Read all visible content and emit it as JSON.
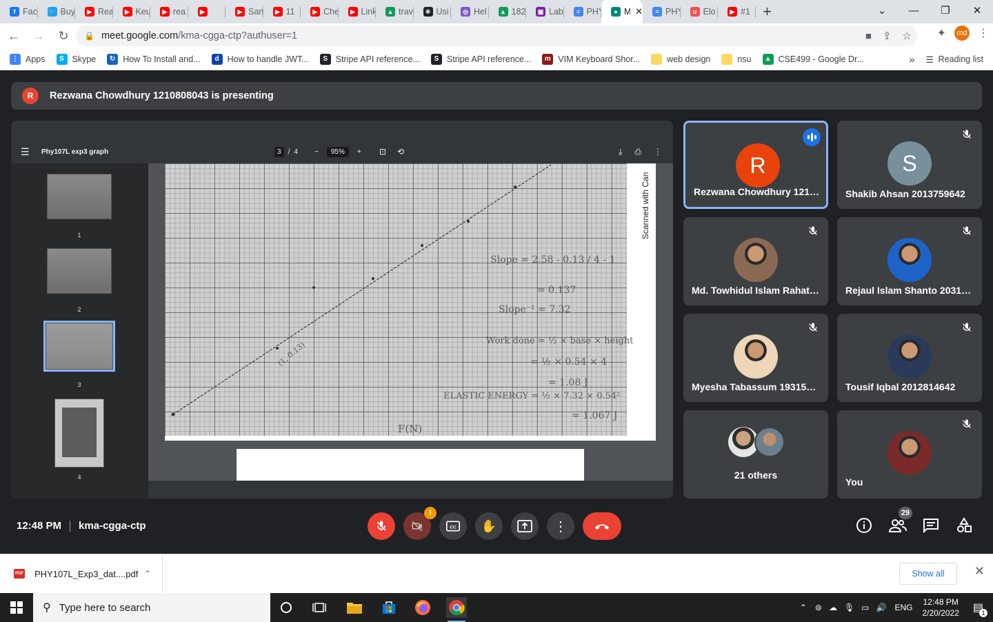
{
  "browser": {
    "tabs": [
      {
        "label": "Face",
        "color": "#1877f2",
        "glyph": "f"
      },
      {
        "label": "Buy",
        "color": "#1da1f2",
        "glyph": "🐦"
      },
      {
        "label": "Rea",
        "color": "#ff0000",
        "glyph": "▶"
      },
      {
        "label": "Keu",
        "color": "#ff0000",
        "glyph": "▶"
      },
      {
        "label": "rea",
        "color": "#ff0000",
        "glyph": "▶"
      },
      {
        "label": "",
        "color": "#ff0000",
        "glyph": "▶"
      },
      {
        "label": "San",
        "color": "#ff0000",
        "glyph": "▶"
      },
      {
        "label": "11",
        "color": "#ff0000",
        "glyph": "▶"
      },
      {
        "label": "Che",
        "color": "#ff0000",
        "glyph": "▶"
      },
      {
        "label": "Link",
        "color": "#ff0000",
        "glyph": "▶"
      },
      {
        "label": "trav",
        "color": "#0f9d58",
        "glyph": "▲"
      },
      {
        "label": "Usi",
        "color": "#20232a",
        "glyph": "⚛"
      },
      {
        "label": "Hel",
        "color": "#7e57c2",
        "glyph": "◎"
      },
      {
        "label": "182",
        "color": "#0f9d58",
        "glyph": "▲"
      },
      {
        "label": "Lab",
        "color": "#7b1fa2",
        "glyph": "▣"
      },
      {
        "label": "PHY",
        "color": "#4285f4",
        "glyph": "≡"
      },
      {
        "label": "M",
        "color": "#00897b",
        "glyph": "●",
        "active": true
      },
      {
        "label": "PHY",
        "color": "#4285f4",
        "glyph": "≡"
      },
      {
        "label": "Elo",
        "color": "#ef5350",
        "glyph": "ʊ"
      },
      {
        "label": "#1",
        "color": "#ff0000",
        "glyph": "▶"
      }
    ],
    "url_host": "meet.google.com",
    "url_path": "/kma-cgga-ctp?authuser=1",
    "profile_initials": "md",
    "bookmarks": [
      {
        "label": "Apps",
        "color": "#4285f4",
        "glyph": "⋮"
      },
      {
        "label": "Skype",
        "color": "#00aff0",
        "glyph": "S"
      },
      {
        "label": "How To Install and...",
        "color": "#1565c0",
        "glyph": "↻"
      },
      {
        "label": "How to handle JWT...",
        "color": "#0d47a1",
        "glyph": "d"
      },
      {
        "label": "Stripe API reference...",
        "color": "#202124",
        "glyph": "S"
      },
      {
        "label": "Stripe API reference...",
        "color": "#202124",
        "glyph": "S"
      },
      {
        "label": "VIM Keyboard Shor...",
        "color": "#8b1a1a",
        "glyph": "m"
      },
      {
        "label": "web design",
        "color": "#fdd663",
        "glyph": ""
      },
      {
        "label": "nsu",
        "color": "#fdd663",
        "glyph": ""
      },
      {
        "label": "CSE499 - Google Dr...",
        "color": "#0f9d58",
        "glyph": "▲"
      }
    ],
    "reading_list": "Reading list"
  },
  "meet": {
    "presenter_initial": "R",
    "presenting_text": "Rezwana Chowdhury 1210808043 is presenting",
    "pdf": {
      "title": "Phy107L exp3 graph",
      "page_current": "3",
      "page_total": "4",
      "zoom": "95%",
      "thumb_labels": [
        "1",
        "2",
        "3",
        "4"
      ],
      "scanned_label": "Scanned with Can",
      "handwriting": {
        "slope": "Slope = 2.58 - 0.13 / 4 - 1",
        "slope_val": "= 0.137",
        "slope_inv": "Slope⁻¹ = 7.32",
        "work": "Work done = ½ × base × height",
        "work2": "= ½ × 0.54 × 4",
        "work3": "= 1.08 J",
        "elastic": "ELASTIC ENERGY = ½ × 7.32 × 0.54²",
        "elastic2": "= 1.067 J",
        "xlabel": "F(N)",
        "point": "(1, 0.13)"
      }
    },
    "participants": [
      {
        "name": "Rezwana Chowdhury 1210...",
        "initial": "R",
        "color": "#e8430a",
        "speaking": true
      },
      {
        "name": "Shakib Ahsan 2013759642",
        "initial": "S",
        "color": "#78909c",
        "muted": true
      },
      {
        "name": "Md. Towhidul Islam Rahat ...",
        "photo": true,
        "muted": true
      },
      {
        "name": "Rejaul Islam Shanto 20313...",
        "photo": true,
        "muted": true
      },
      {
        "name": "Myesha Tabassum 1931527...",
        "photo": true,
        "muted": true
      },
      {
        "name": "Tousif Iqbal 2012814642",
        "photo": true,
        "muted": true
      },
      {
        "name": "21 others",
        "others": true
      },
      {
        "name": "You",
        "photo": true,
        "muted": true
      }
    ],
    "time": "12:48 PM",
    "meeting_code": "kma-cgga-ctp",
    "participant_count": "29",
    "camera_alert": "!"
  },
  "downloads": {
    "file": "PHY107L_Exp3_dat....pdf",
    "show_all": "Show all"
  },
  "taskbar": {
    "search_placeholder": "Type here to search",
    "language": "ENG",
    "time": "12:48 PM",
    "date": "2/20/2022",
    "notification_count": "1"
  }
}
